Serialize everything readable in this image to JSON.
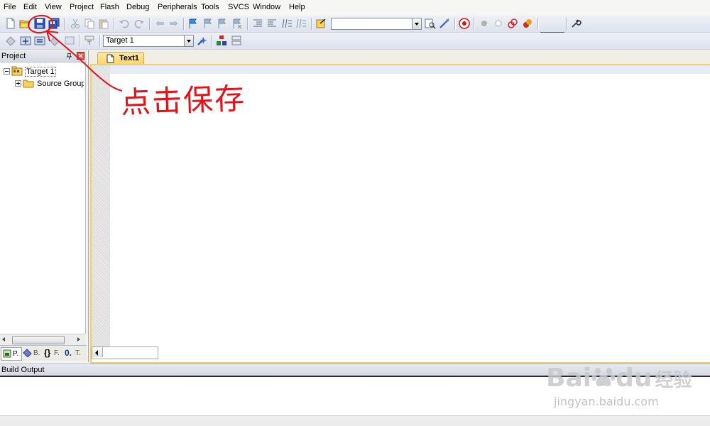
{
  "menu": [
    "File",
    "Edit",
    "View",
    "Project",
    "Flash",
    "Debug",
    "Peripherals",
    "Tools",
    "SVCS",
    "Window",
    "Help"
  ],
  "toolbar2": {
    "target_combo": "Target 1"
  },
  "project_panel": {
    "title": "Project",
    "tree": {
      "root": "Target 1",
      "child": "Source Group"
    },
    "tabs": [
      "P.",
      "B.",
      "F.",
      "T."
    ]
  },
  "editor": {
    "tab_label": "Text1"
  },
  "build_output": {
    "title": "Build Output"
  },
  "annotation": {
    "text": "点击保存",
    "color": "#e0141c"
  },
  "watermark": {
    "logo": "Bai",
    "logo2": "du",
    "logo3": "经验",
    "url": "jingyan.baidu.com"
  },
  "colors": {
    "tab_active": "#ffd568",
    "toolbar": "#dde2ee",
    "accent": "#e0141c"
  }
}
